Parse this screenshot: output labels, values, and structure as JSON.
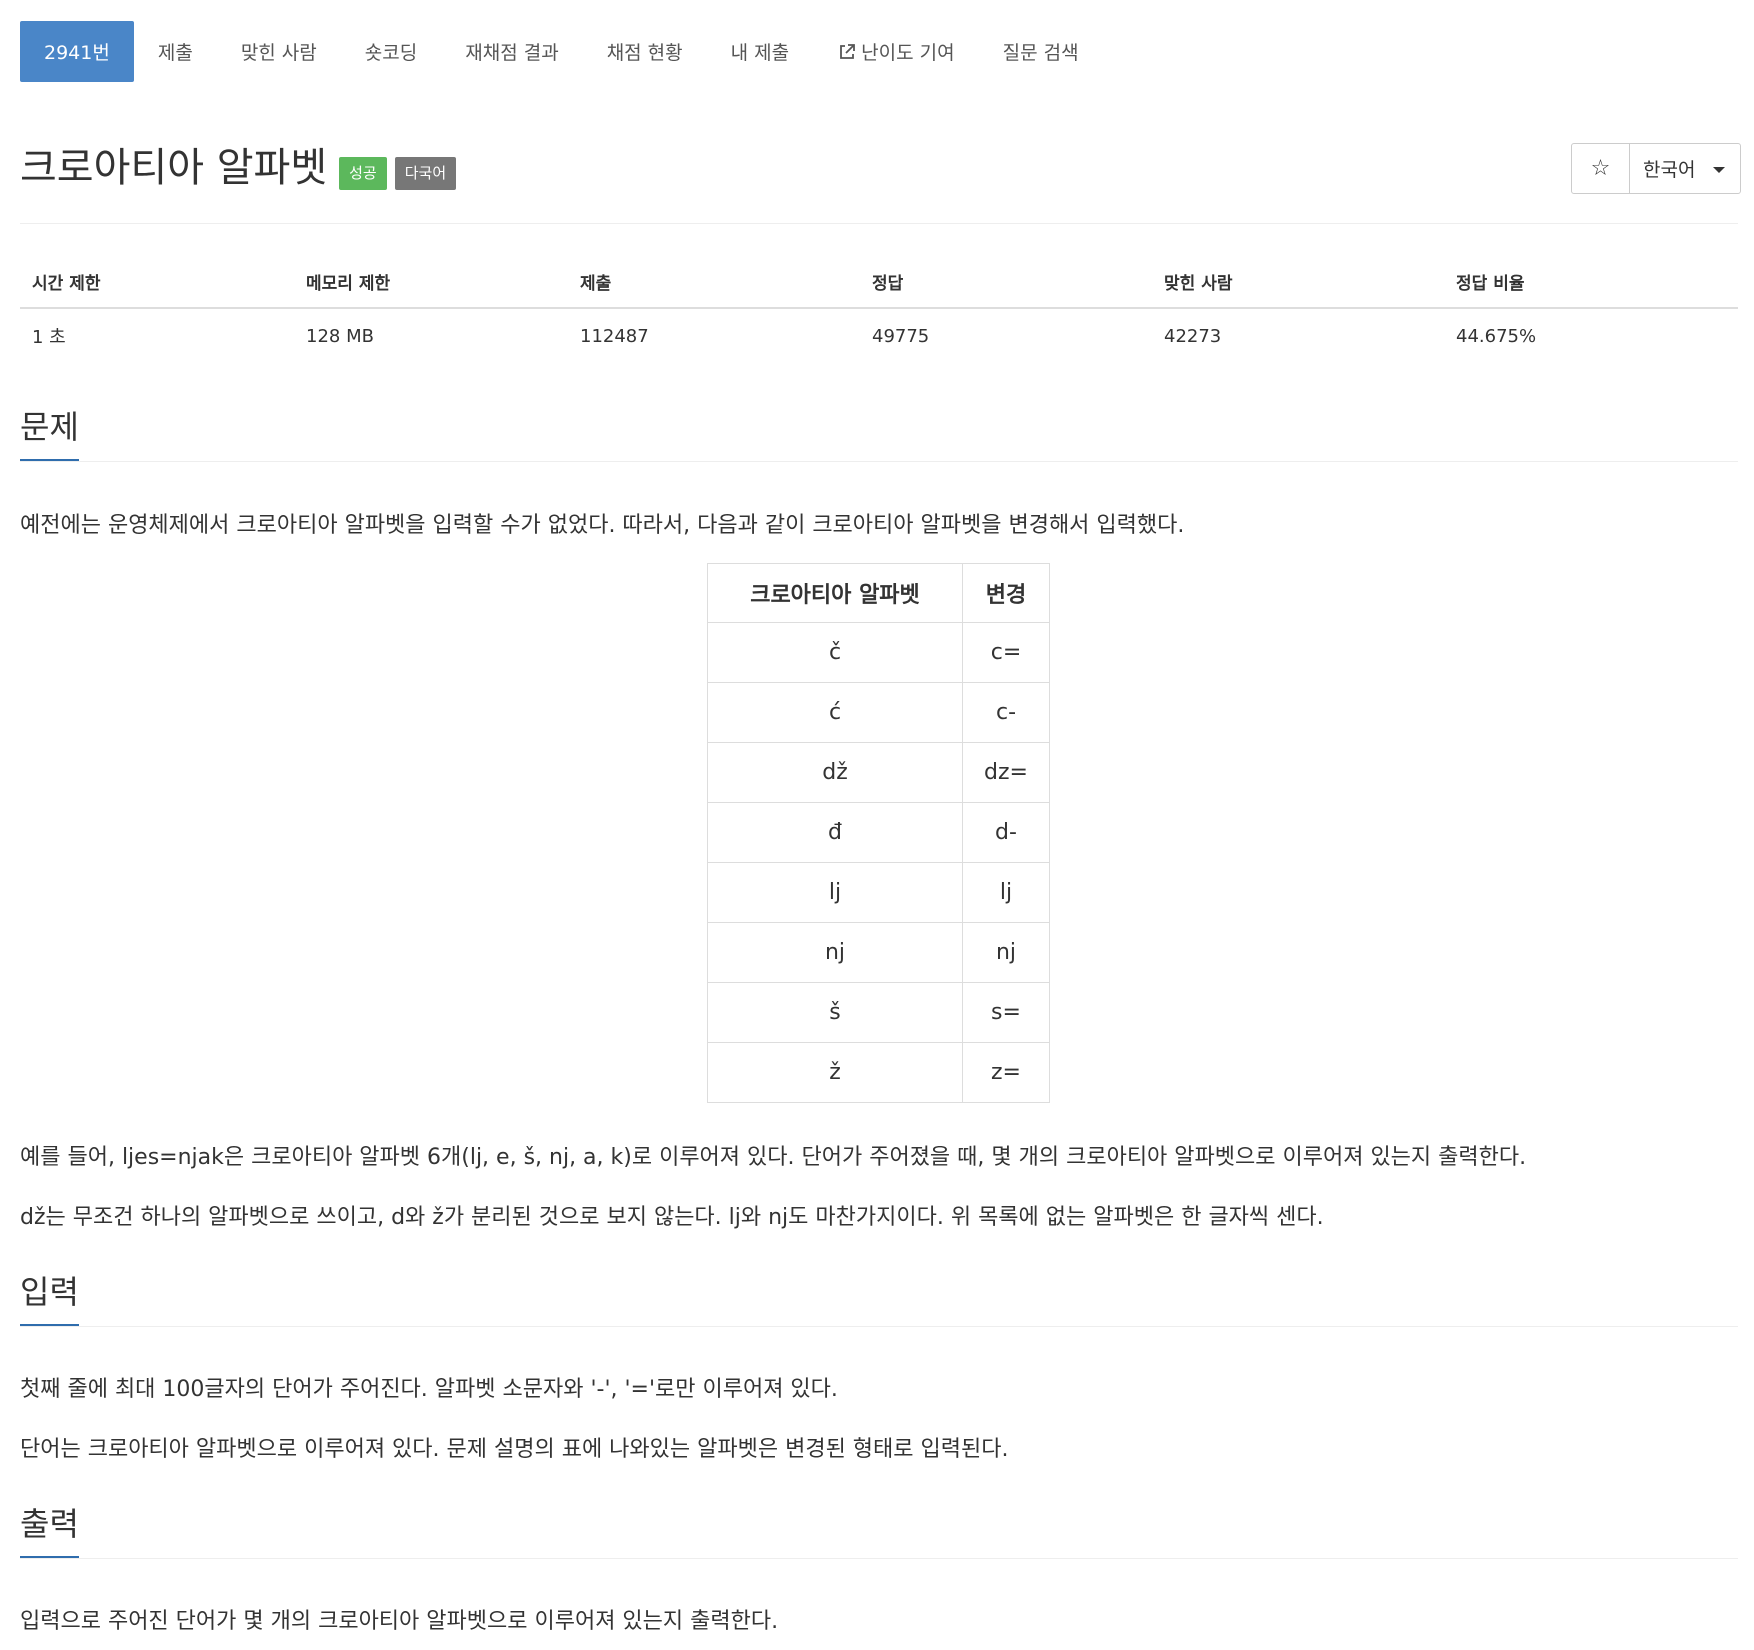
{
  "nav": {
    "items": [
      {
        "label": "2941번",
        "active": true
      },
      {
        "label": "제출"
      },
      {
        "label": "맞힌 사람"
      },
      {
        "label": "숏코딩"
      },
      {
        "label": "재채점 결과"
      },
      {
        "label": "채점 현황"
      },
      {
        "label": "내 제출"
      },
      {
        "label": "난이도 기여",
        "icon": "external-link-icon"
      },
      {
        "label": "질문 검색"
      }
    ]
  },
  "problem": {
    "title": "크로아티아 알파벳",
    "labels": {
      "status": "성공",
      "multi_language": "다국어"
    }
  },
  "controls": {
    "star_icon": "☆",
    "language": "한국어"
  },
  "info": {
    "headers": [
      "시간 제한",
      "메모리 제한",
      "제출",
      "정답",
      "맞힌 사람",
      "정답 비율"
    ],
    "values": [
      "1 초",
      "128 MB",
      "112487",
      "49775",
      "42273",
      "44.675%"
    ]
  },
  "sections": {
    "problem": {
      "title": "문제",
      "intro": "예전에는 운영체제에서 크로아티아 알파벳을 입력할 수가 없었다. 따라서, 다음과 같이 크로아티아 알파벳을 변경해서 입력했다.",
      "para2": "예를 들어, ljes=njak은 크로아티아 알파벳 6개(lj, e, š, nj, a, k)로 이루어져 있다. 단어가 주어졌을 때, 몇 개의 크로아티아 알파벳으로 이루어져 있는지 출력한다.",
      "para3": "dž는 무조건 하나의 알파벳으로 쓰이고, d와 ž가 분리된 것으로 보지 않는다. lj와 nj도 마찬가지이다. 위 목록에 없는 알파벳은 한 글자씩 센다."
    },
    "input": {
      "title": "입력",
      "para1": "첫째 줄에 최대 100글자의 단어가 주어진다. 알파벳 소문자와 '-', '='로만 이루어져 있다.",
      "para2": "단어는 크로아티아 알파벳으로 이루어져 있다. 문제 설명의 표에 나와있는 알파벳은 변경된 형태로 입력된다."
    },
    "output": {
      "title": "출력",
      "para1": "입력으로 주어진 단어가 몇 개의 크로아티아 알파벳으로 이루어져 있는지 출력한다."
    }
  },
  "conversion_table": {
    "headers": [
      "크로아티아 알파벳",
      "변경"
    ],
    "rows": [
      [
        "č",
        "c="
      ],
      [
        "ć",
        "c-"
      ],
      [
        "dž",
        "dz="
      ],
      [
        "đ",
        "d-"
      ],
      [
        "lj",
        "lj"
      ],
      [
        "nj",
        "nj"
      ],
      [
        "š",
        "s="
      ],
      [
        "ž",
        "z="
      ]
    ]
  }
}
